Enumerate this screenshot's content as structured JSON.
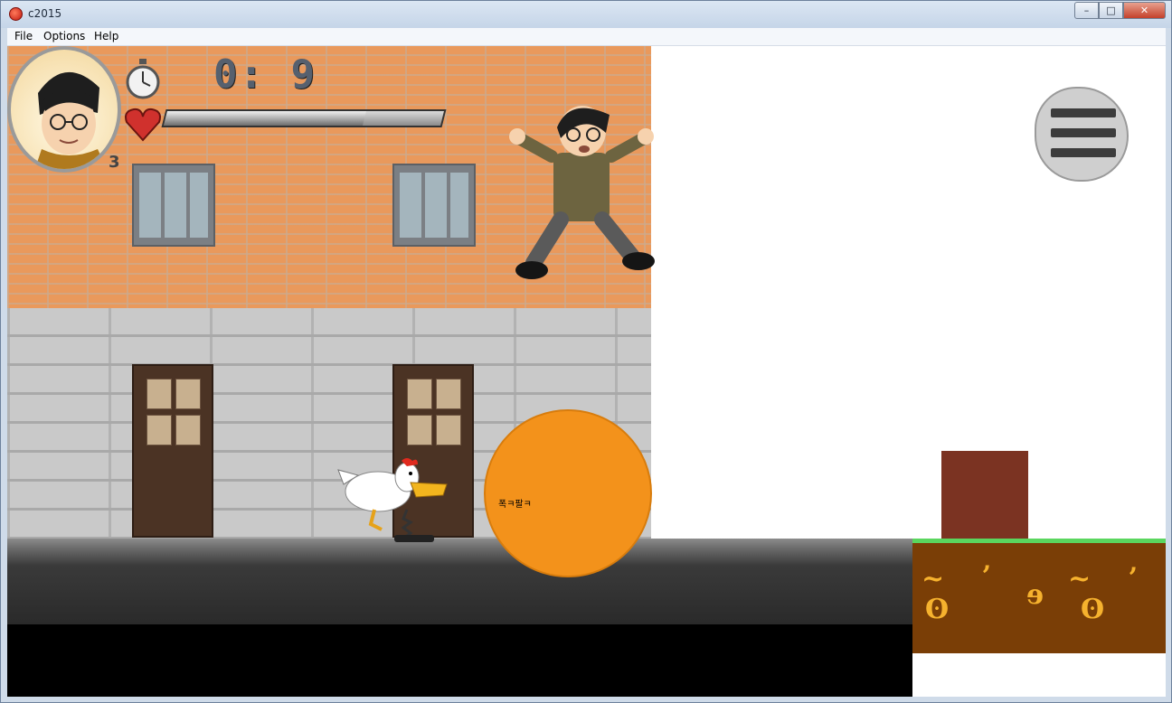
{
  "window": {
    "title": "c2015",
    "minimize_symbol": "–",
    "maximize_symbol": "□",
    "close_symbol": "✕"
  },
  "menu": {
    "items": [
      "File",
      "Options",
      "Help"
    ]
  },
  "hud": {
    "timer": "0: 9",
    "lives": "3",
    "health_fraction": 0.72,
    "icons": [
      "clock-icon",
      "heart-icon",
      "pause-icon"
    ]
  },
  "scene": {
    "ball_text": "폭ㅋ팔ㅋ",
    "colors": {
      "brick": "#e9995c",
      "stone": "#c9c9c9",
      "ball": "#f3921b",
      "grass": "#5ad65e",
      "dirt": "#7a3e06",
      "crate": "#7b3322"
    }
  }
}
